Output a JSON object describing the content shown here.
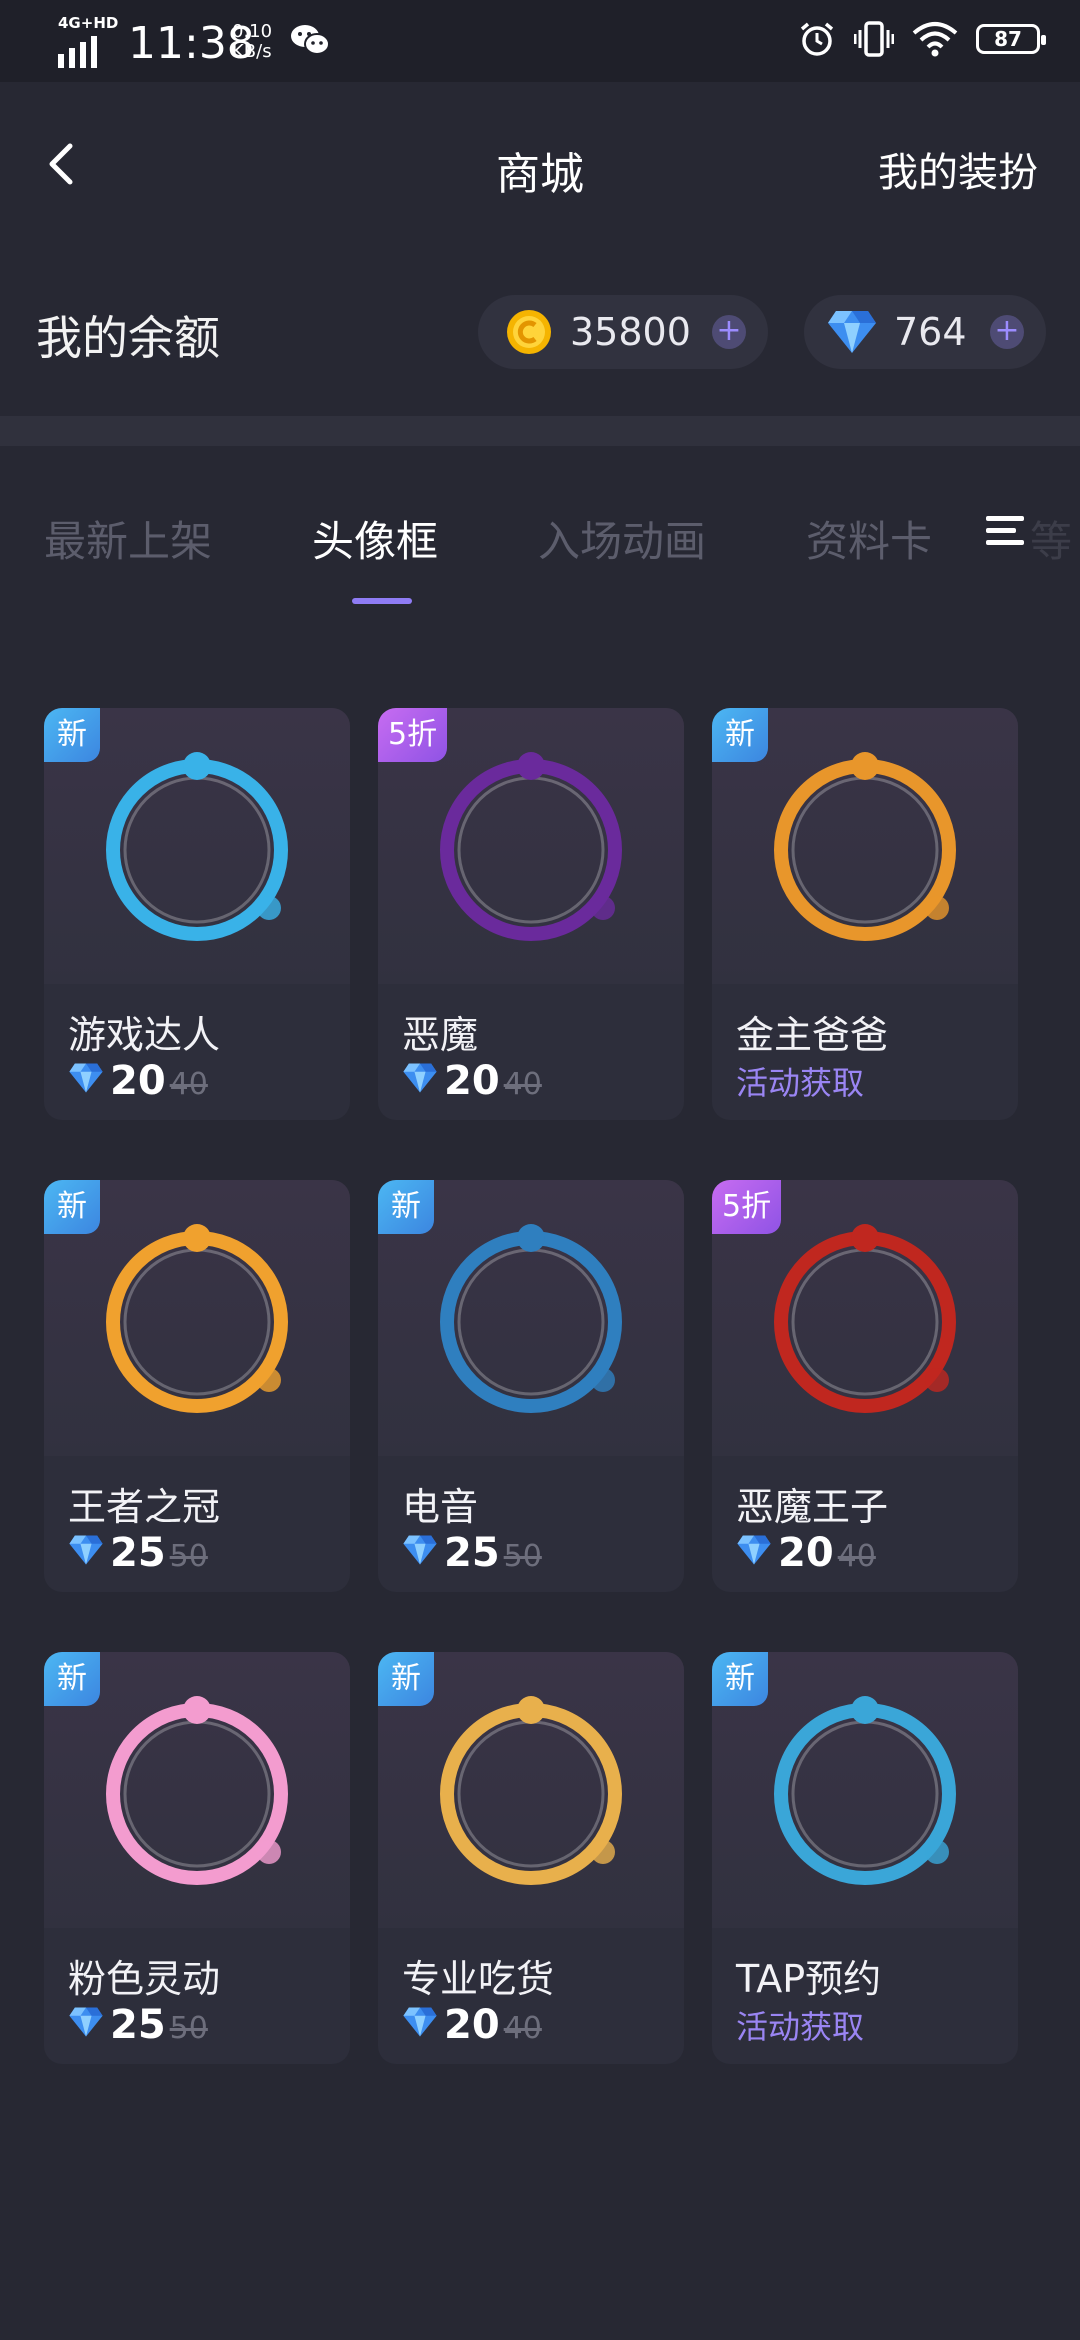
{
  "status_bar": {
    "network": "4G+HD",
    "time": "11:38",
    "speed_value": "0.10",
    "speed_unit": "KB/s",
    "battery": "87"
  },
  "header": {
    "title": "商城",
    "right_action": "我的装扮"
  },
  "balance": {
    "label": "我的余额",
    "coins": "35800",
    "gems": "764"
  },
  "tabs": [
    "最新上架",
    "头像框",
    "入场动画",
    "资料卡",
    "等"
  ],
  "active_tab_index": 1,
  "items": [
    {
      "badge": "新",
      "badge_type": "new",
      "name": "游戏达人",
      "price": "20",
      "original_price": "40",
      "frame_color": "#39b2e8"
    },
    {
      "badge": "5折",
      "badge_type": "sale",
      "name": "恶魔",
      "price": "20",
      "original_price": "40",
      "frame_color": "#6a2a9c"
    },
    {
      "badge": "新",
      "badge_type": "new",
      "name": "金主爸爸",
      "activity": "活动获取",
      "frame_color": "#e8962b"
    },
    {
      "badge": "新",
      "badge_type": "new",
      "name": "王者之冠",
      "price": "25",
      "original_price": "50",
      "frame_color": "#f0a12e"
    },
    {
      "badge": "新",
      "badge_type": "new",
      "name": "电音",
      "price": "25",
      "original_price": "50",
      "frame_color": "#2f7fbf"
    },
    {
      "badge": "5折",
      "badge_type": "sale",
      "name": "恶魔王子",
      "price": "20",
      "original_price": "40",
      "frame_color": "#c0271f"
    },
    {
      "badge": "新",
      "badge_type": "new",
      "name": "粉色灵动",
      "price": "25",
      "original_price": "50",
      "frame_color": "#f39ccf"
    },
    {
      "badge": "新",
      "badge_type": "new",
      "name": "专业吃货",
      "price": "20",
      "original_price": "40",
      "frame_color": "#e8b04c"
    },
    {
      "badge": "新",
      "badge_type": "new",
      "name": "TAP预约",
      "activity": "活动获取",
      "frame_color": "#3aa6d8"
    }
  ]
}
